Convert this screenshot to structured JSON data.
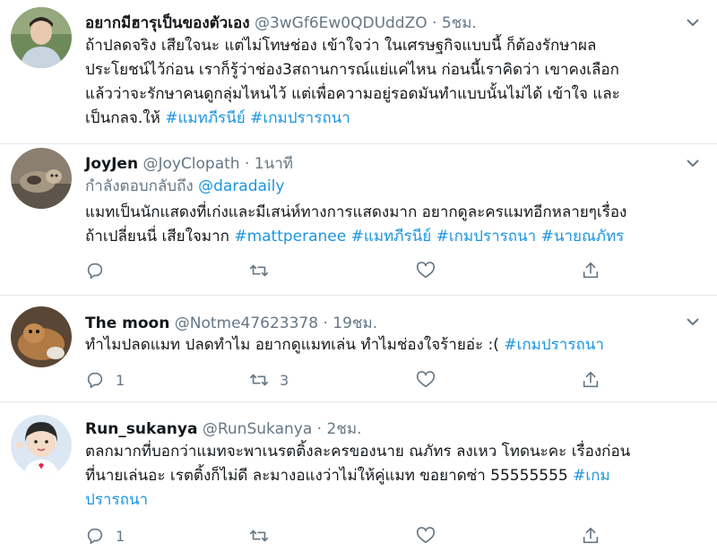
{
  "tweets": [
    {
      "name": "อยากมีฮารุเป็นของตัวเอง",
      "handle": "@3wGf6Ew0QDUddZO",
      "sep": "·",
      "time": "5ชม.",
      "lines": [
        [
          {
            "t": "ถ้าปลดจริง เสียใจนะ แต่ไม่โทษช่อง เข้าใจว่า ในเศรษฐกิจแบบนี้ ก็ต้องรักษาผล"
          }
        ],
        [
          {
            "t": "ประโยชน์ไว้ก่อน เราก็รู้ว่าช่อง3สถานการณ์แย่แค่ไหน ก่อนนี้เราคิดว่า เขาคงเลือก"
          }
        ],
        [
          {
            "t": "แล้วว่าจะรักษาคนดูกลุ่มไหนไว้ แต่เพื่อความอยู่รอดมันทำแบบนั้นไม่ได้ เข้าใจ และ"
          }
        ],
        [
          {
            "t": "เป็นกลจ.ให้ "
          },
          {
            "t": "#แมทภีรนีย์",
            "tag": true
          },
          {
            "t": " "
          },
          {
            "t": "#เกมปรารถนา",
            "tag": true
          }
        ]
      ]
    },
    {
      "name": "JoyJen",
      "handle": "@JoyClopath",
      "sep": "·",
      "time": "1นาที",
      "reply_prefix": "กำลังตอบกลับถึง ",
      "reply_to": "@daradaily",
      "lines": [
        [
          {
            "t": "แมทเป็นนักแสดงที่เก่งและมีเสน่ห์ทางการแสดงมาก อยากดูละครแมทอีกหลายๆเรื่อง"
          }
        ],
        [
          {
            "t": "ถ้าเปลี่ยนนี่ เสียใจมาก "
          },
          {
            "t": "#mattperanee",
            "tag": true
          },
          {
            "t": " "
          },
          {
            "t": "#แมทภีรนีย์",
            "tag": true
          },
          {
            "t": " "
          },
          {
            "t": "#เกมปรารถนา",
            "tag": true
          },
          {
            "t": " "
          },
          {
            "t": "#นายณภัทร",
            "tag": true
          }
        ]
      ],
      "reply_count": "",
      "retweet_count": ""
    },
    {
      "name": "The moon",
      "handle": "@Notme47623378",
      "sep": "·",
      "time": "19ชม.",
      "lines": [
        [
          {
            "t": "ทำไมปลดแมท ปลดทำไม อยากดูแมทเล่น ทำไมช่องใจร้ายอ่ะ :( "
          },
          {
            "t": "#เกมปรารถนา",
            "tag": true
          }
        ]
      ],
      "reply_count": "1",
      "retweet_count": "3"
    },
    {
      "name": "Run_sukanya",
      "handle": "@RunSukanya",
      "sep": "·",
      "time": "2ชม.",
      "lines": [
        [
          {
            "t": "ตลกมากที่บอกว่าแมทจะพาเนรตติ้งละครของนาย ณภัทร ลงเหว โทดนะคะ เรื่องก่อน"
          }
        ],
        [
          {
            "t": "ที่นายเล่นอะ เรตติ้งก็ไม่ดี ละมางอแงว่าไม่ให้คู่แมท ขอยาดซ่า 55555555 "
          },
          {
            "t": "#เกม",
            "tag": true
          }
        ],
        [
          {
            "t": "ปรารถนา",
            "tag": true
          }
        ]
      ],
      "reply_count": "1",
      "retweet_count": ""
    }
  ],
  "icons": {
    "chevron": "chevron-down-icon",
    "reply": "reply-icon",
    "retweet": "retweet-icon",
    "like": "like-icon",
    "share": "share-icon"
  },
  "colors": {
    "link": "#1b95e0",
    "muted": "#657786",
    "separator": "#e1e8ed"
  }
}
